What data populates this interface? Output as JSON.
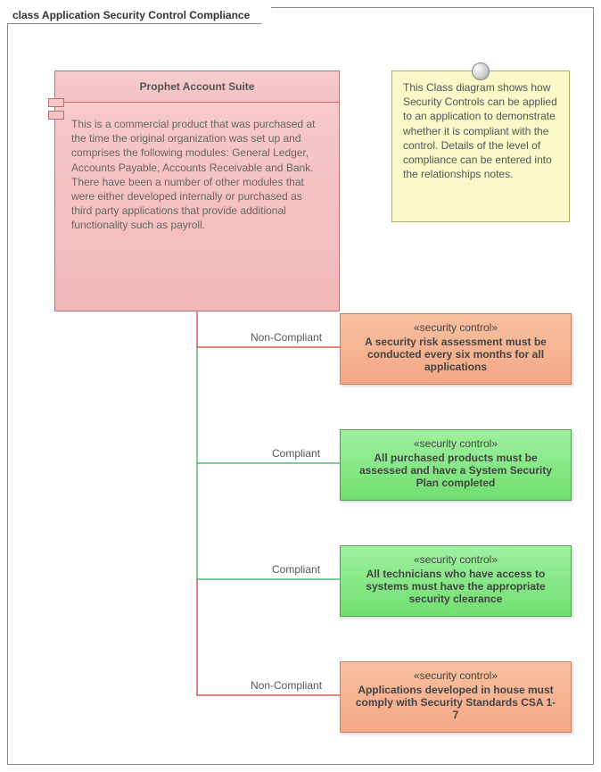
{
  "frame": {
    "title": "class Application Security Control Compliance"
  },
  "component": {
    "title": "Prophet Account Suite",
    "body": "This is a commercial product that was purchased at the time the original organization was set up and comprises the following modules: General Ledger, Accounts Payable, Accounts Receivable and Bank. There have been a number of other modules that were either developed internally or purchased as third party applications that provide additional functionality such as payroll."
  },
  "note": {
    "text": "This Class diagram shows how Security Controls can be applied to an application to demonstrate whether it is compliant with the control. Details of the level of compliance can be entered into the relationships notes."
  },
  "controls": [
    {
      "stereo": "«security control»",
      "text": "A security risk assessment must be conducted every six months for all applications",
      "link_label": "Non-Compliant"
    },
    {
      "stereo": "«security control»",
      "text": "All purchased products must be assessed and have a System Security Plan completed",
      "link_label": "Compliant"
    },
    {
      "stereo": "«security control»",
      "text": "All technicians who have access to systems must have the appropriate security clearance",
      "link_label": "Compliant"
    },
    {
      "stereo": "«security control»",
      "text": "Applications developed in house must comply with Security Standards CSA 1-7",
      "link_label": "Non-Compliant"
    }
  ],
  "colors": {
    "non_compliant_line": "#cc0000",
    "compliant_line": "#009933"
  }
}
